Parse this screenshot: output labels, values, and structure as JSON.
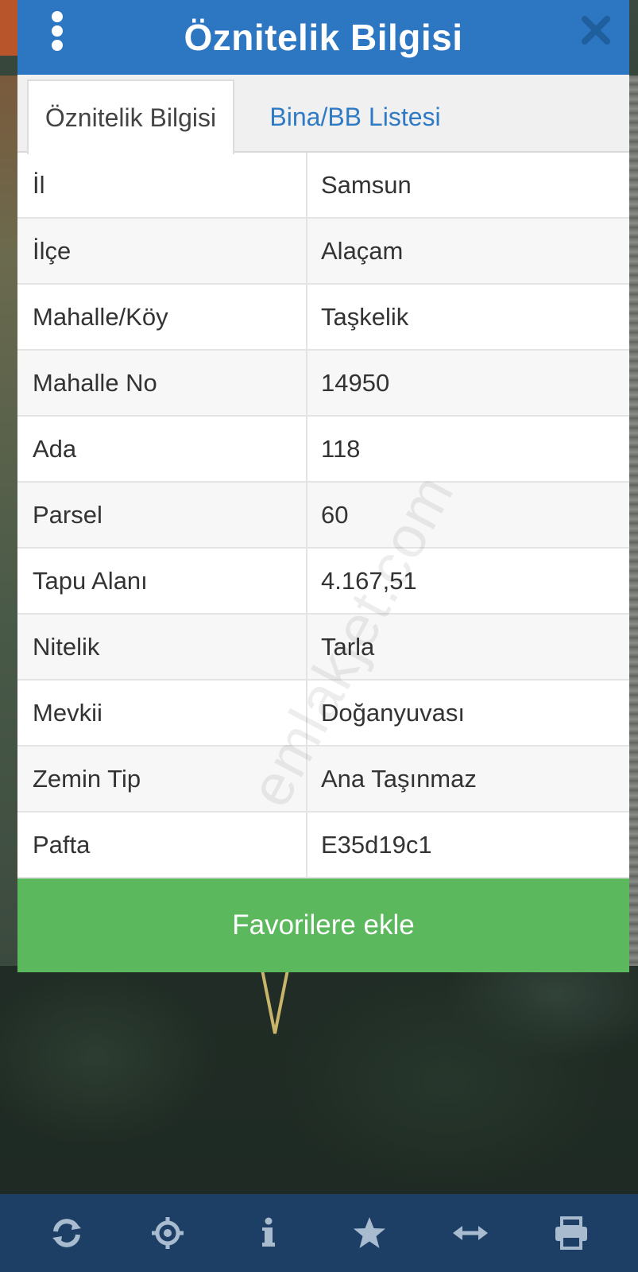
{
  "dialog": {
    "title": "Öznitelik Bilgisi"
  },
  "tabs": [
    {
      "label": "Öznitelik Bilgisi",
      "active": true
    },
    {
      "label": "Bina/BB Listesi",
      "active": false
    }
  ],
  "attributes": [
    {
      "key": "İl",
      "value": "Samsun"
    },
    {
      "key": "İlçe",
      "value": "Alaçam"
    },
    {
      "key": "Mahalle/Köy",
      "value": "Taşkelik"
    },
    {
      "key": "Mahalle No",
      "value": "14950"
    },
    {
      "key": "Ada",
      "value": "118"
    },
    {
      "key": "Parsel",
      "value": "60"
    },
    {
      "key": "Tapu Alanı",
      "value": "4.167,51"
    },
    {
      "key": "Nitelik",
      "value": "Tarla"
    },
    {
      "key": "Mevkii",
      "value": "Doğanyuvası"
    },
    {
      "key": "Zemin Tip",
      "value": "Ana Taşınmaz"
    },
    {
      "key": "Pafta",
      "value": "E35d19c1"
    }
  ],
  "favorite_button": {
    "label": "Favorilere ekle"
  },
  "watermark": "emlakjet.com",
  "toolbar": {
    "items": [
      "refresh-icon",
      "locate-icon",
      "info-icon",
      "star-icon",
      "measure-icon",
      "print-icon"
    ]
  },
  "colors": {
    "header": "#2d76c2",
    "tab_active_text": "#444444",
    "tab_inactive_text": "#2f7ac4",
    "favorite_button": "#5cb85c",
    "toolbar": "#1d3f66"
  }
}
